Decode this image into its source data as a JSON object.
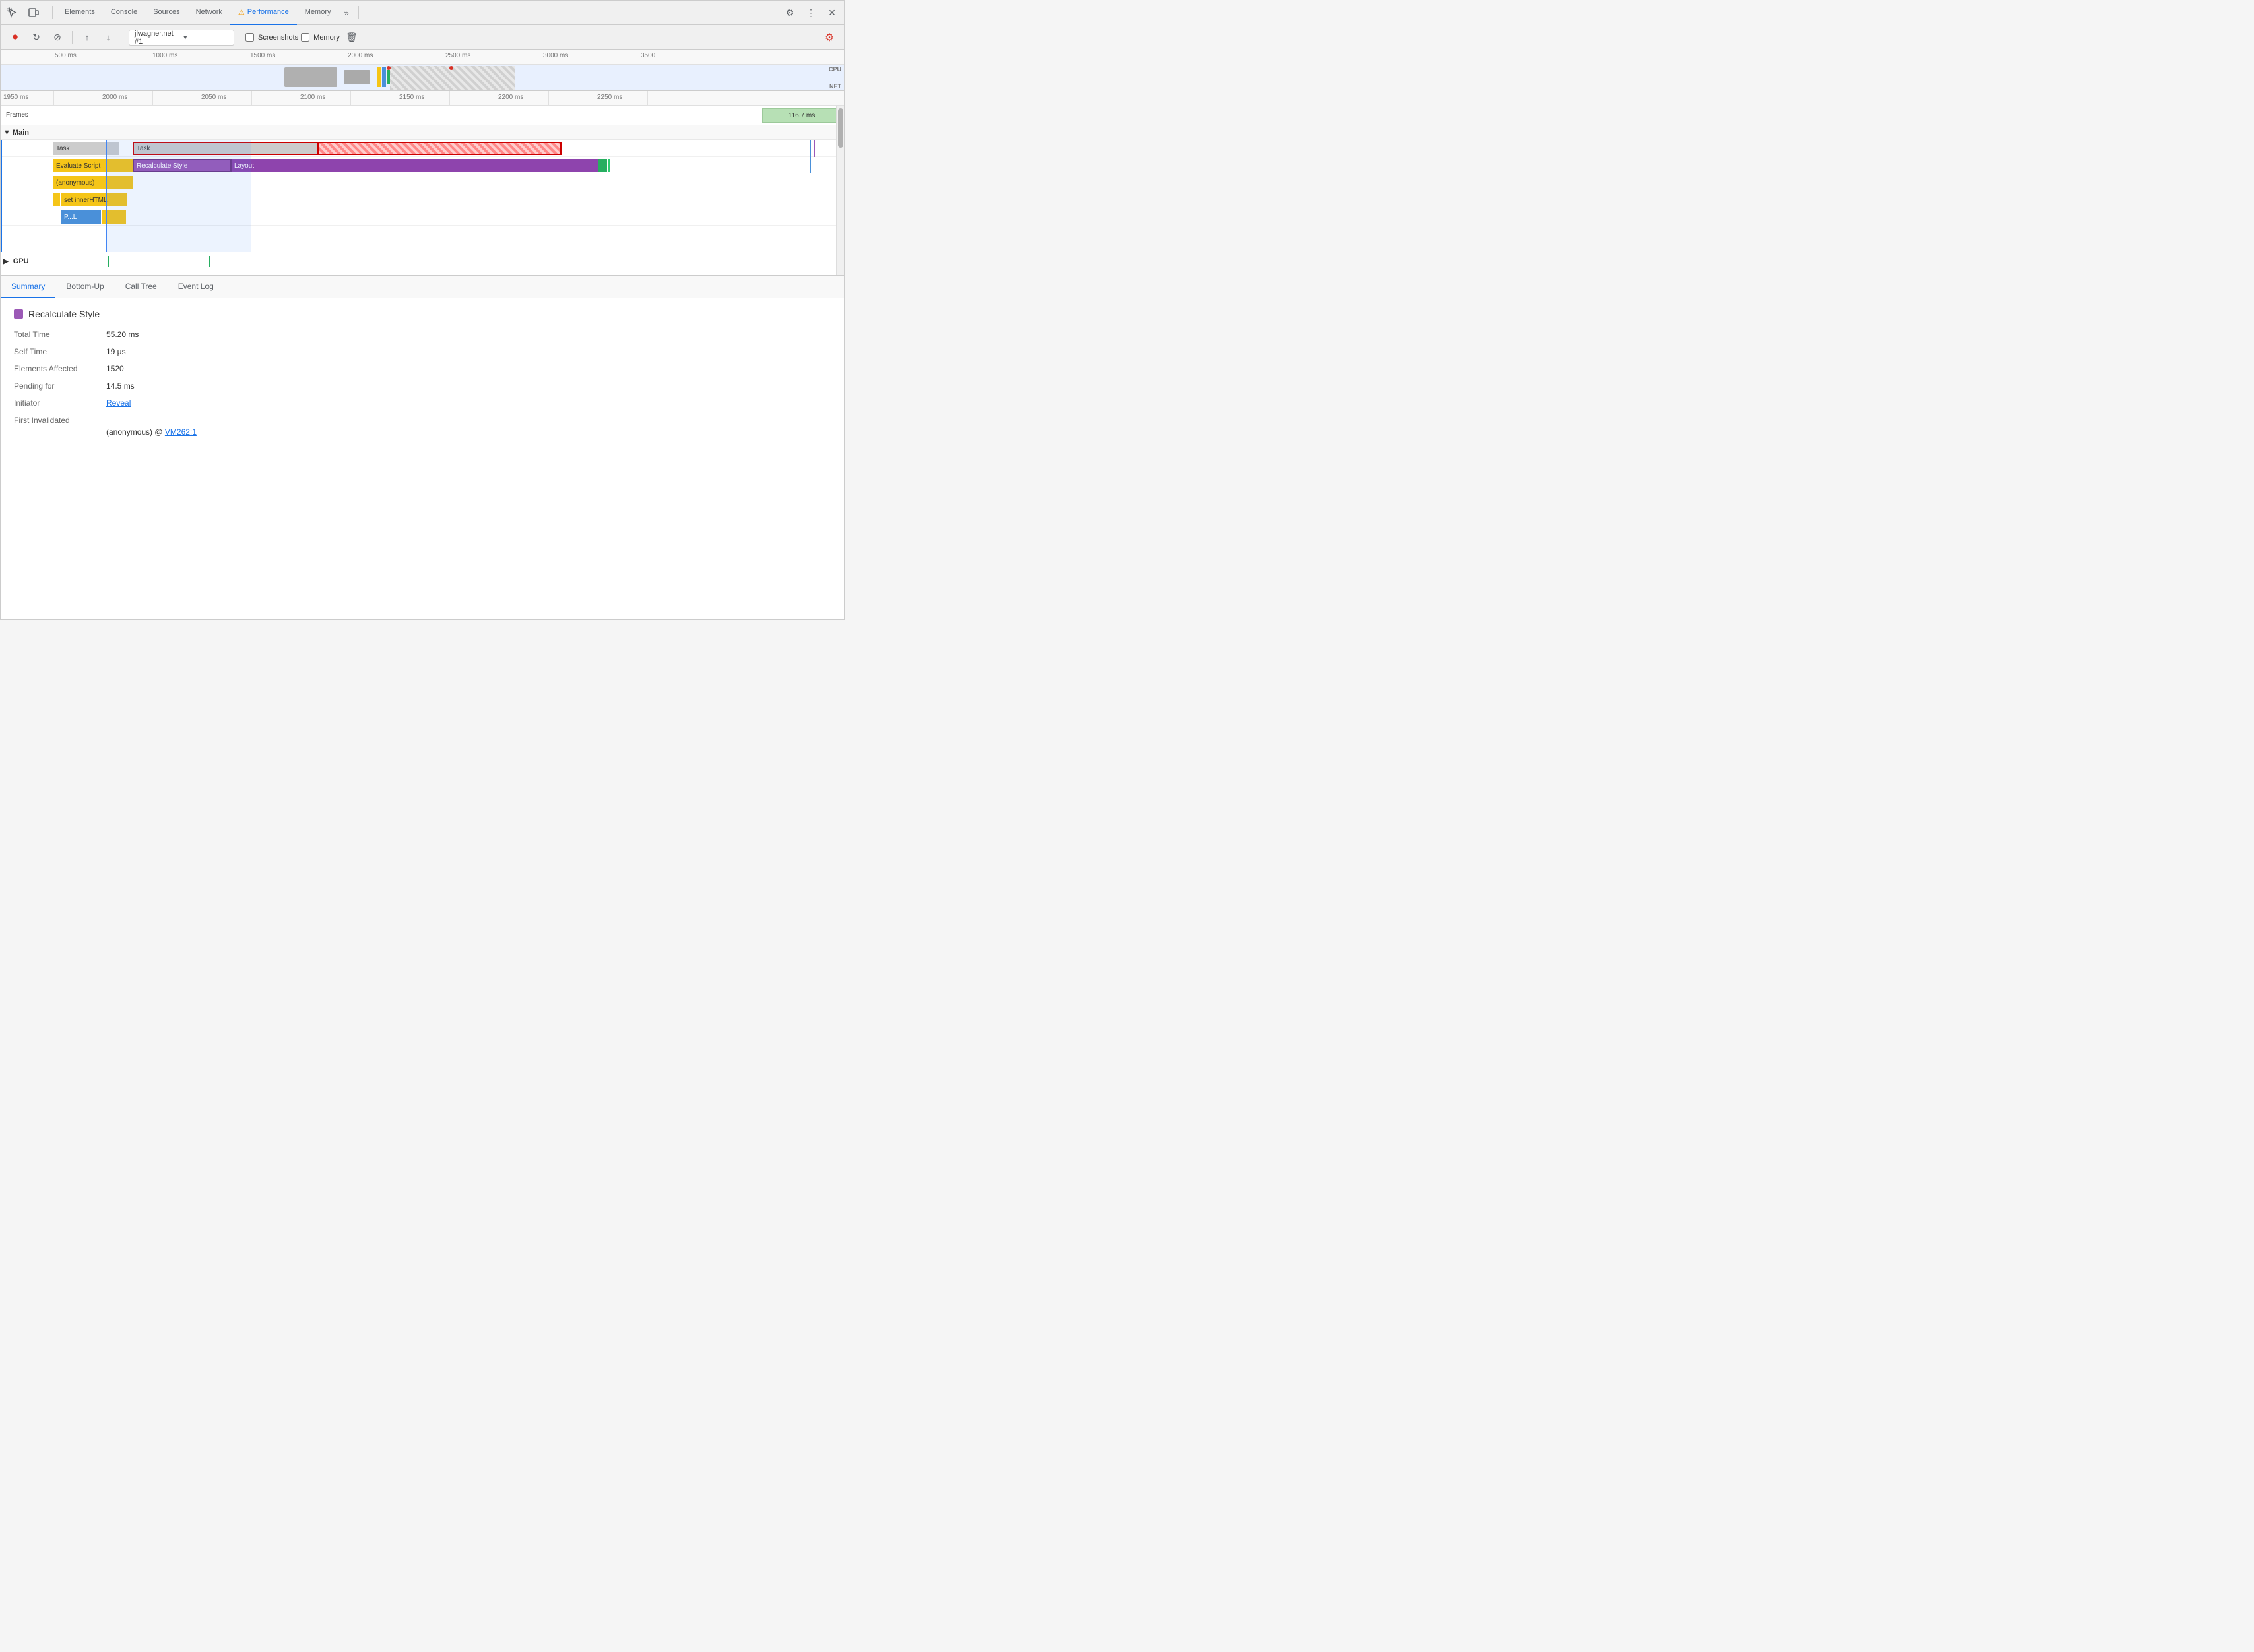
{
  "tabs": {
    "items": [
      {
        "label": "Elements",
        "active": false
      },
      {
        "label": "Console",
        "active": false
      },
      {
        "label": "Sources",
        "active": false
      },
      {
        "label": "Network",
        "active": false
      },
      {
        "label": "Performance",
        "active": true,
        "warning": true
      },
      {
        "label": "Memory",
        "active": false
      }
    ],
    "more_label": "»"
  },
  "toolbar": {
    "url": "jlwagner.net #1",
    "screenshots_label": "Screenshots",
    "memory_label": "Memory"
  },
  "timeline_overview": {
    "ruler_labels": [
      "500 ms",
      "1000 ms",
      "1500 ms",
      "2000 ms",
      "2500 ms",
      "3000 ms",
      "3500"
    ],
    "cpu_label": "CPU",
    "net_label": "NET"
  },
  "detail_ruler": {
    "labels": [
      "1950 ms",
      "2000 ms",
      "2050 ms",
      "2100 ms",
      "2150 ms",
      "2200 ms",
      "2250 ms"
    ]
  },
  "frames_row": {
    "label": "Frames",
    "block_value": "116.7 ms"
  },
  "main_section": {
    "label": "▼ Main",
    "tasks": [
      {
        "label": "Task",
        "type": "gray"
      },
      {
        "label": "Task",
        "type": "gray"
      },
      {
        "label": "Evaluate Script",
        "type": "yellow"
      },
      {
        "label": "Recalculate Style",
        "type": "purple",
        "selected": true
      },
      {
        "label": "Layout",
        "type": "layout"
      },
      {
        "label": "(anonymous)",
        "type": "yellow_light"
      },
      {
        "label": "set innerHTML",
        "type": "yellow"
      },
      {
        "label": "P...L",
        "type": "blue"
      }
    ]
  },
  "gpu_section": {
    "label": "▶ GPU"
  },
  "bottom_tabs": {
    "items": [
      {
        "label": "Summary",
        "active": true
      },
      {
        "label": "Bottom-Up",
        "active": false
      },
      {
        "label": "Call Tree",
        "active": false
      },
      {
        "label": "Event Log",
        "active": false
      }
    ]
  },
  "summary": {
    "title": "Recalculate Style",
    "color": "#9b59b6",
    "rows": [
      {
        "key": "Total Time",
        "value": "55.20 ms"
      },
      {
        "key": "Self Time",
        "value": "19 μs"
      },
      {
        "key": "Elements Affected",
        "value": "1520"
      },
      {
        "key": "Pending for",
        "value": "14.5 ms"
      },
      {
        "key": "Initiator",
        "value": "Reveal",
        "is_link": true
      },
      {
        "key": "First Invalidated",
        "value": ""
      },
      {
        "indent_label": "(anonymous)",
        "indent_link": "VM262:1",
        "indent_sep": " @ "
      }
    ]
  }
}
